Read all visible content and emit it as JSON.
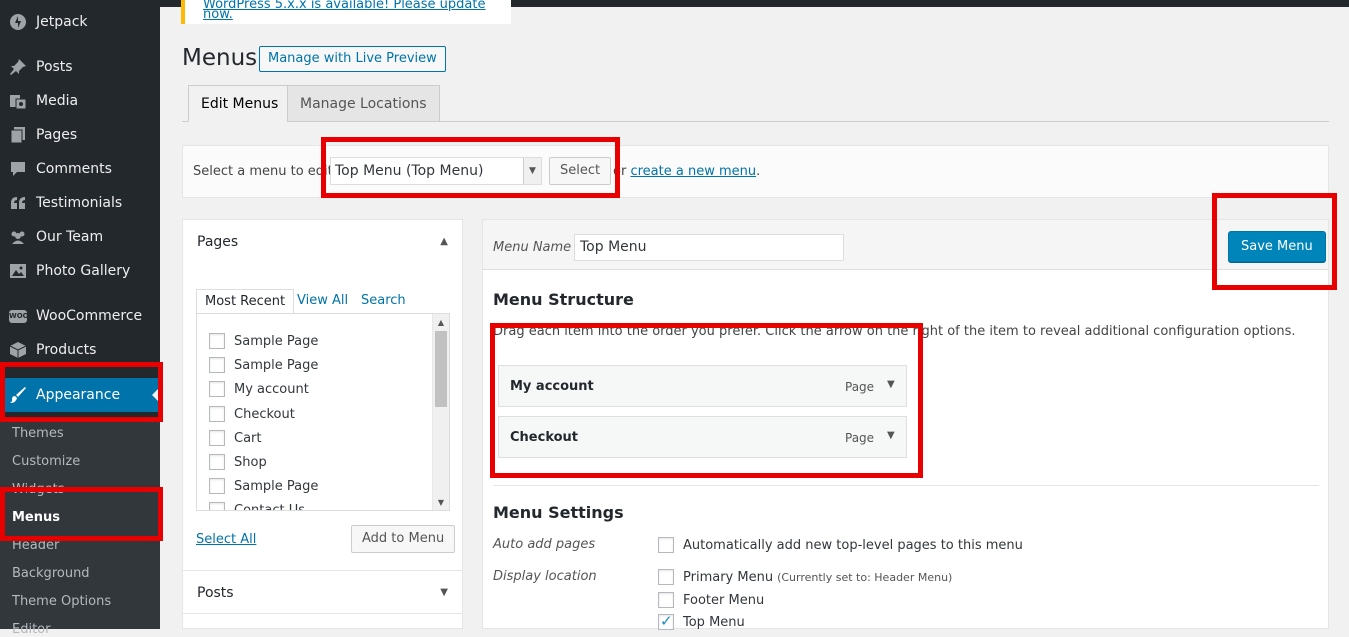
{
  "notice": {
    "text": "WordPress 5.x.x is available! Please update now."
  },
  "sidebar": {
    "items": [
      {
        "label": "Jetpack",
        "icon": "jetpack-icon"
      },
      {
        "label": "Posts",
        "icon": "pin-icon"
      },
      {
        "label": "Media",
        "icon": "media-icon"
      },
      {
        "label": "Pages",
        "icon": "pages-icon"
      },
      {
        "label": "Comments",
        "icon": "comments-icon"
      },
      {
        "label": "Testimonials",
        "icon": "quote-icon"
      },
      {
        "label": "Our Team",
        "icon": "team-icon"
      },
      {
        "label": "Photo Gallery",
        "icon": "gallery-icon"
      },
      {
        "label": "WooCommerce",
        "icon": "woo-icon",
        "badge": "WOO"
      },
      {
        "label": "Products",
        "icon": "box-icon"
      },
      {
        "label": "Appearance",
        "icon": "brush-icon"
      }
    ],
    "submenu": [
      "Themes",
      "Customize",
      "Widgets",
      "Menus",
      "Header",
      "Background",
      "Theme Options",
      "Editor"
    ]
  },
  "header": {
    "title": "Menus",
    "live_preview_label": "Manage with Live Preview",
    "tabs": [
      {
        "label": "Edit Menus"
      },
      {
        "label": "Manage Locations"
      }
    ]
  },
  "manage": {
    "select_label": "Select a menu to edit:",
    "selected_menu": "Top Menu (Top Menu)",
    "select_button": "Select",
    "or_text": "or",
    "create_link": "create a new menu",
    "period": "."
  },
  "pages_box": {
    "title": "Pages",
    "tabs": [
      "Most Recent",
      "View All",
      "Search"
    ],
    "items": [
      "Sample Page",
      "Sample Page",
      "My account",
      "Checkout",
      "Cart",
      "Shop",
      "Sample Page",
      "Contact Us"
    ],
    "select_all": "Select All",
    "add_button": "Add to Menu"
  },
  "posts_box": {
    "title": "Posts"
  },
  "editor": {
    "menu_name_label": "Menu Name",
    "menu_name_value": "Top Menu",
    "save_button": "Save Menu",
    "structure_title": "Menu Structure",
    "structure_desc": "Drag each item into the order you prefer. Click the arrow on the right of the item to reveal additional configuration options.",
    "entries": [
      {
        "title": "My account",
        "type": "Page"
      },
      {
        "title": "Checkout",
        "type": "Page"
      }
    ],
    "settings_title": "Menu Settings",
    "auto_add_label": "Auto add pages",
    "auto_add_option": "Automatically add new top-level pages to this menu",
    "display_location_label": "Display location",
    "locations": [
      {
        "label": "Primary Menu",
        "note": "(Currently set to: Header Menu)",
        "checked": false
      },
      {
        "label": "Footer Menu",
        "note": "",
        "checked": false
      },
      {
        "label": "Top Menu",
        "note": "",
        "checked": true
      }
    ]
  },
  "colors": {
    "sidebar_bg": "#23282d",
    "accent": "#0073aa",
    "highlight": "#e80000",
    "primary_button": "#0085ba"
  }
}
